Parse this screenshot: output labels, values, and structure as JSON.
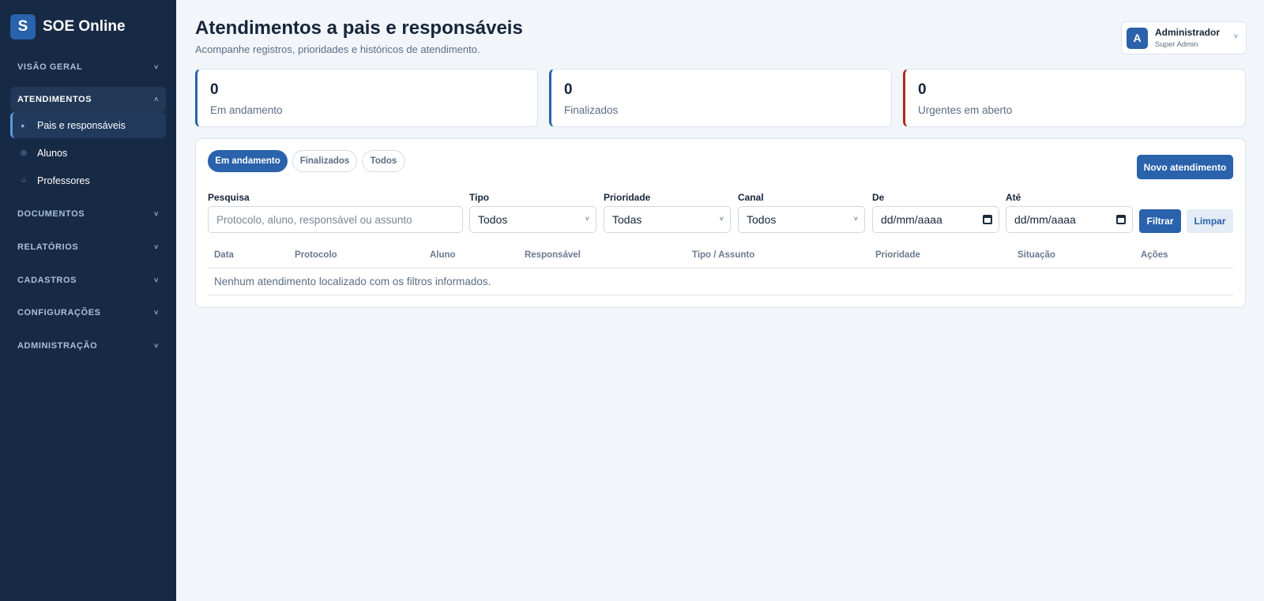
{
  "app": {
    "logo_letter": "S",
    "name": "SOE Online"
  },
  "sidebar": {
    "sections": [
      {
        "label": "VISÃO GERAL",
        "expanded": false
      },
      {
        "label": "ATENDIMENTOS",
        "expanded": true
      },
      {
        "label": "DOCUMENTOS",
        "expanded": false
      },
      {
        "label": "RELATÓRIOS",
        "expanded": false
      },
      {
        "label": "CADASTROS",
        "expanded": false
      },
      {
        "label": "CONFIGURAÇÕES",
        "expanded": false
      },
      {
        "label": "ADMINISTRAÇÃO",
        "expanded": false
      }
    ],
    "sub_items": [
      {
        "label": "Pais e responsáveis",
        "icon": "person-icon",
        "active": true
      },
      {
        "label": "Alunos",
        "icon": "student-icon",
        "active": false
      },
      {
        "label": "Professores",
        "icon": "teacher-icon",
        "active": false
      }
    ],
    "chevron_collapsed": "˅",
    "chevron_expanded": "˄"
  },
  "header": {
    "title": "Atendimentos a pais e responsáveis",
    "subtitle": "Acompanhe registros, prioridades e históricos de atendimento."
  },
  "user": {
    "avatar_letter": "A",
    "name": "Administrador",
    "role": "Super Admin"
  },
  "stats": [
    {
      "value": "0",
      "label": "Em andamento"
    },
    {
      "value": "0",
      "label": "Finalizados"
    },
    {
      "value": "0",
      "label": "Urgentes em aberto"
    }
  ],
  "tabs": [
    {
      "label": "Em andamento",
      "active": true
    },
    {
      "label": "Finalizados",
      "active": false
    },
    {
      "label": "Todos",
      "active": false
    }
  ],
  "new_button": "Novo atendimento",
  "filters": {
    "search": {
      "label": "Pesquisa",
      "placeholder": "Protocolo, aluno, responsável ou assunto"
    },
    "tipo": {
      "label": "Tipo",
      "value": "Todos"
    },
    "prioridade": {
      "label": "Prioridade",
      "value": "Todas"
    },
    "canal": {
      "label": "Canal",
      "value": "Todos"
    },
    "de": {
      "label": "De",
      "value": "dd/mm/aaaa"
    },
    "ate": {
      "label": "Até",
      "value": "dd/mm/aaaa"
    },
    "filter_button": "Filtrar",
    "clear_button": "Limpar"
  },
  "table": {
    "columns": [
      "Data",
      "Protocolo",
      "Aluno",
      "Responsável",
      "Tipo / Assunto",
      "Prioridade",
      "Situação",
      "Ações"
    ],
    "empty_message": "Nenhum atendimento localizado com os filtros informados."
  },
  "colors": {
    "sidebar": "#172a45",
    "accent": "#2a62ab",
    "urgent": "#b3261e",
    "background": "#f2f6fb"
  }
}
